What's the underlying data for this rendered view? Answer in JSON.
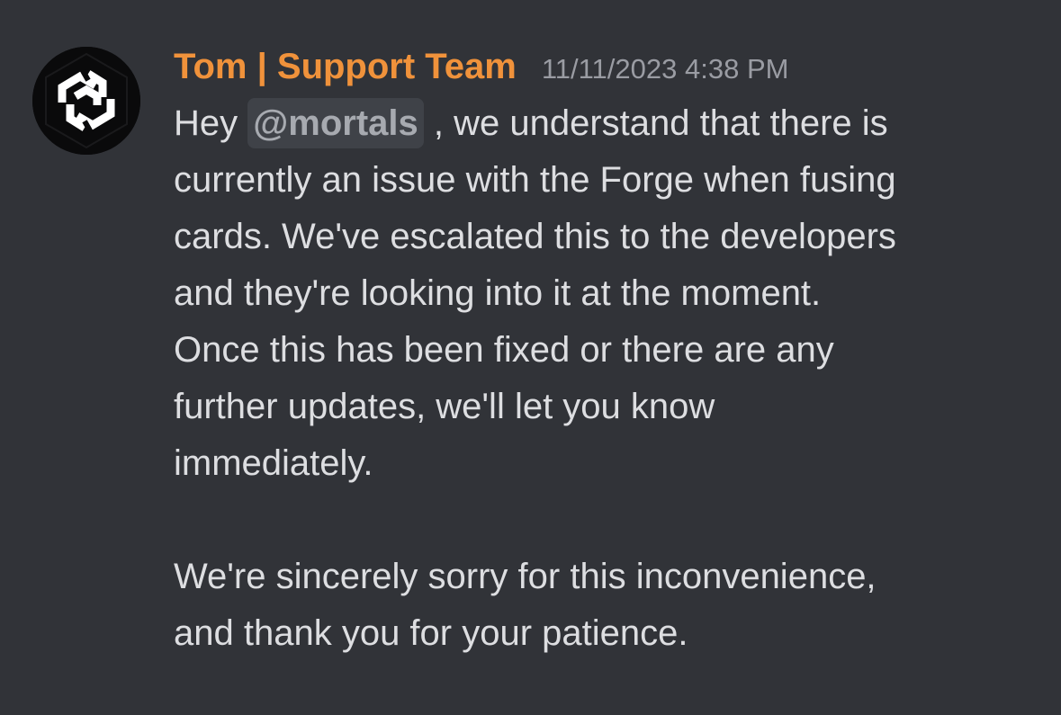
{
  "message": {
    "author": "Tom | Support Team",
    "timestamp": "11/11/2023 4:38 PM",
    "avatar_icon": "hexagon-logo-icon",
    "colors": {
      "background": "#313338",
      "author": "#f0923b",
      "timestamp": "#9a9ca3",
      "text": "#dddee1",
      "mention_bg": "#3f4248"
    },
    "body": {
      "greeting": "Hey",
      "mention": "@mortals",
      "line1_rest": ", we understand that there is",
      "line2": "currently an issue with the Forge when fusing",
      "line3": "cards. We've escalated this to the developers",
      "line4": "and they're looking into it at the moment.",
      "line5": "Once this has been fixed or there are any",
      "line6": "further updates, we'll let you know",
      "line7": "immediately.",
      "line8": "We're sincerely sorry for this inconvenience,",
      "line9": "and thank you for your patience."
    }
  }
}
